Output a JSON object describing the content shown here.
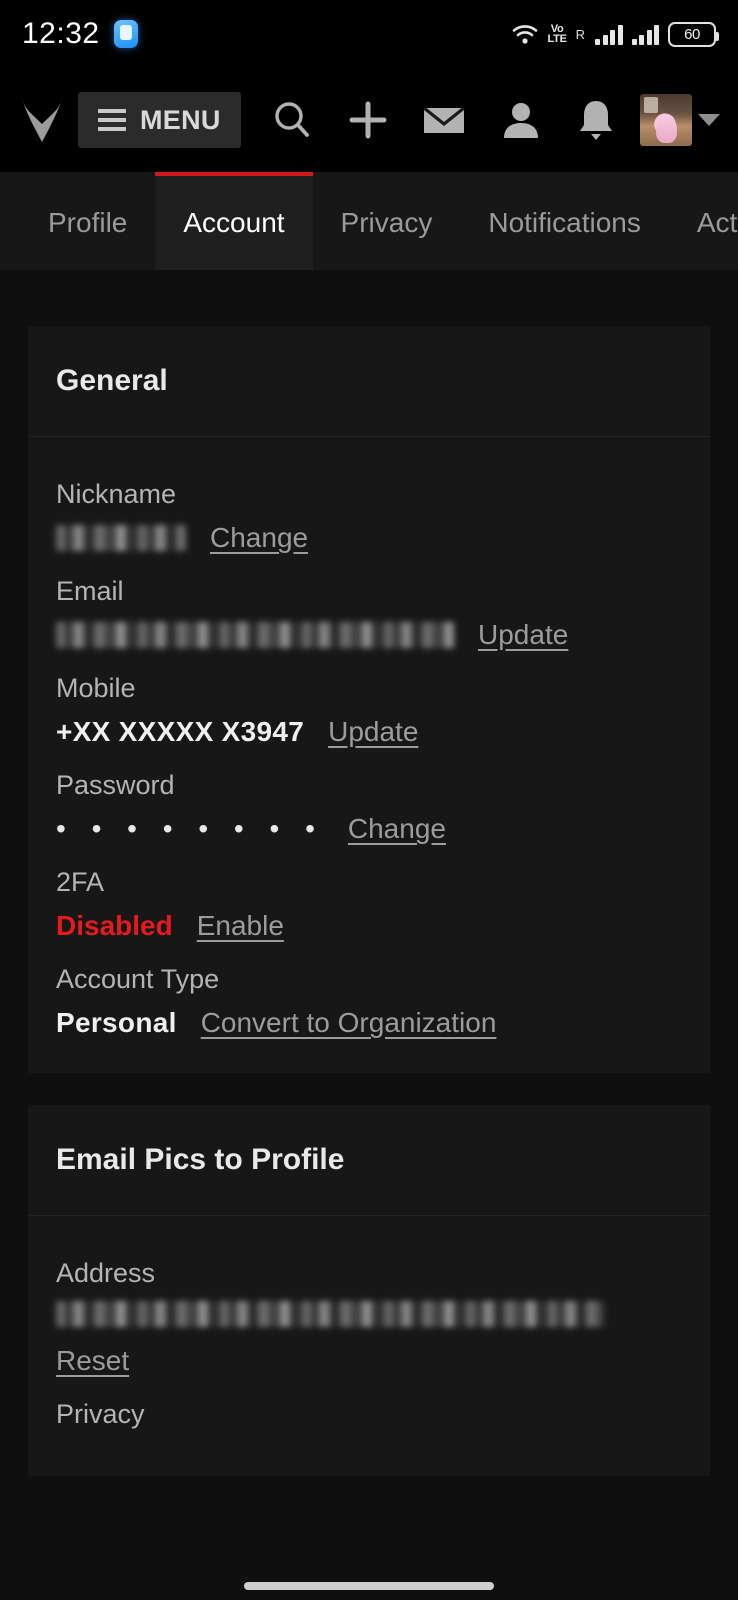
{
  "status_bar": {
    "clock": "12:32",
    "icons": [
      "chip-icon",
      "wifi-icon",
      "volte-icon",
      "signal-icon",
      "roaming-icon",
      "signal-icon",
      "battery-icon"
    ],
    "volte_line1": "Vo",
    "volte_line2": "LTE",
    "roaming": "R",
    "battery_percent": "60"
  },
  "app_bar": {
    "logo": "site-logo",
    "menu_label": "MENU",
    "icons": [
      "search-icon",
      "plus-icon",
      "mail-icon",
      "person-icon",
      "bell-icon"
    ],
    "avatar": "user-avatar",
    "caret": "chevron-down-icon"
  },
  "tabs": [
    {
      "label": "Profile",
      "active": false
    },
    {
      "label": "Account",
      "active": true
    },
    {
      "label": "Privacy",
      "active": false
    },
    {
      "label": "Notifications",
      "active": false
    },
    {
      "label": "Activi",
      "active": false
    }
  ],
  "accent_colors": {
    "active_tab_underline": "#d11b1b",
    "danger": "#e51b1b",
    "page_background": "#0f0f0f",
    "card_background": "#171717"
  },
  "sections": [
    {
      "title": "General",
      "fields": [
        {
          "label": "Nickname",
          "value": "",
          "redacted": true,
          "action": "Change"
        },
        {
          "label": "Email",
          "value": "",
          "redacted": true,
          "action": "Update"
        },
        {
          "label": "Mobile",
          "value": "+XX XXXXX X3947",
          "redacted": false,
          "action": "Update"
        },
        {
          "label": "Password",
          "value": "• • • • • • • •",
          "redacted": false,
          "action": "Change"
        },
        {
          "label": "2FA",
          "value": "Disabled",
          "redacted": false,
          "action": "Enable",
          "danger": true
        },
        {
          "label": "Account Type",
          "value": "Personal",
          "redacted": false,
          "action": "Convert to Organization"
        }
      ]
    },
    {
      "title": "Email Pics to Profile",
      "fields": [
        {
          "label": "Address",
          "value": "",
          "redacted": true,
          "action": "Reset"
        },
        {
          "label": "Privacy",
          "value": "",
          "redacted": false,
          "action": ""
        }
      ]
    }
  ]
}
